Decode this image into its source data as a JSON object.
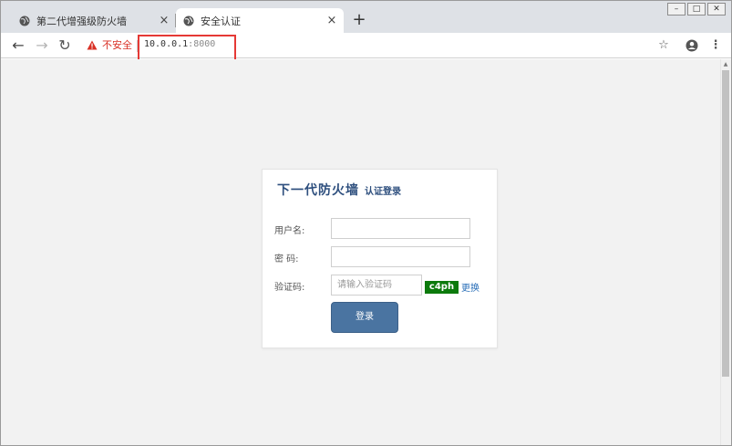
{
  "tabs": [
    {
      "title": "第二代增强级防火墙",
      "close": "×",
      "active": false
    },
    {
      "title": "安全认证",
      "close": "×",
      "active": true
    }
  ],
  "new_tab": "+",
  "toolbar": {
    "security_label": "不安全",
    "url_host": "10.0.0.1",
    "url_port": ":8000"
  },
  "login": {
    "title": "下一代防火墙",
    "subtitle": "认证登录",
    "username_label": "用户名:",
    "password_label": "密 码:",
    "captcha_label": "验证码:",
    "captcha_placeholder": "请输入验证码",
    "captcha_text": "c4ph",
    "refresh_label": "更换",
    "submit_label": "登录"
  },
  "colors": {
    "brand": "#2e4f7e",
    "button": "#4a74a1",
    "warning": "#d93025",
    "captcha_bg": "#0c7a0c",
    "highlight": "#e53935"
  },
  "icons": [
    "globe-icon",
    "close-icon",
    "plus-icon",
    "back-icon",
    "forward-icon",
    "reload-icon",
    "warning-icon",
    "star-icon",
    "account-icon",
    "menu-icon"
  ]
}
